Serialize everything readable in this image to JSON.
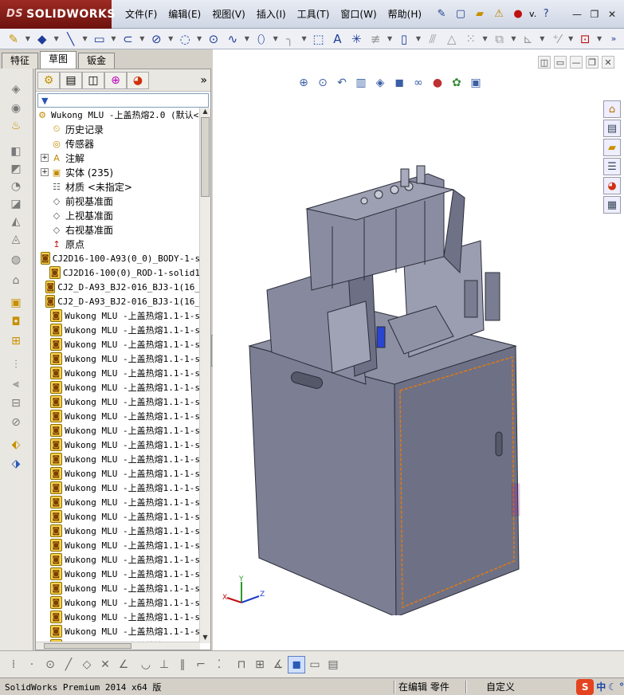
{
  "app": {
    "logo_text": "SOLIDWORKS",
    "logo_prefix": "DS",
    "menu": [
      "文件(F)",
      "编辑(E)",
      "视图(V)",
      "插入(I)",
      "工具(T)",
      "窗口(W)",
      "帮助(H)"
    ],
    "title_user": "v.",
    "title_help": "?"
  },
  "manager_tabs": [
    "特征",
    "草图",
    "钣金"
  ],
  "active_manager_tab": "草图",
  "tree": {
    "root": "Wukong MLU -上盖热熔2.0 (默认<",
    "items": [
      {
        "label": "历史记录",
        "icon": "history-icon",
        "expand": false,
        "cjk": true
      },
      {
        "label": "传感器",
        "icon": "sensor-icon",
        "expand": false,
        "cjk": true
      },
      {
        "label": "注解",
        "icon": "annotation-icon",
        "expand": true,
        "cjk": true
      },
      {
        "label": "实体 (235)",
        "icon": "solid-bodies-icon",
        "expand": true,
        "cjk": true
      },
      {
        "label": "材质 <未指定>",
        "icon": "material-icon",
        "expand": false,
        "cjk": true
      },
      {
        "label": "前视基准面",
        "icon": "plane-icon",
        "expand": false,
        "cjk": true
      },
      {
        "label": "上视基准面",
        "icon": "plane-icon",
        "expand": false,
        "cjk": true
      },
      {
        "label": "右视基准面",
        "icon": "plane-icon",
        "expand": false,
        "cjk": true
      },
      {
        "label": "原点",
        "icon": "origin-icon",
        "expand": false,
        "cjk": true
      },
      {
        "label": "CJ2D16-100-A93(0_0)_BODY-1-s",
        "icon": "part-icon",
        "expand": false,
        "cjk": false
      },
      {
        "label": "CJ2D16-100(0)_ROD-1-solid1",
        "icon": "part-icon",
        "expand": false,
        "cjk": false
      },
      {
        "label": "CJ2_D-A93_BJ2-016_BJ3-1(16_",
        "icon": "part-icon",
        "expand": false,
        "cjk": false
      },
      {
        "label": "CJ2_D-A93_BJ2-016_BJ3-1(16_",
        "icon": "part-icon",
        "expand": false,
        "cjk": false
      },
      {
        "label": "Wukong MLU -上盖热熔1.1-1-s",
        "icon": "part-icon",
        "expand": false,
        "cjk": false
      },
      {
        "label": "Wukong MLU -上盖热熔1.1-1-s",
        "icon": "part-icon",
        "expand": false,
        "cjk": false
      },
      {
        "label": "Wukong MLU -上盖热熔1.1-1-s",
        "icon": "part-icon",
        "expand": false,
        "cjk": false
      },
      {
        "label": "Wukong MLU -上盖热熔1.1-1-s",
        "icon": "part-icon",
        "expand": false,
        "cjk": false
      },
      {
        "label": "Wukong MLU -上盖热熔1.1-1-s",
        "icon": "part-icon",
        "expand": false,
        "cjk": false
      },
      {
        "label": "Wukong MLU -上盖热熔1.1-1-s",
        "icon": "part-icon",
        "expand": false,
        "cjk": false
      },
      {
        "label": "Wukong MLU -上盖热熔1.1-1-s",
        "icon": "part-icon",
        "expand": false,
        "cjk": false
      },
      {
        "label": "Wukong MLU -上盖热熔1.1-1-s",
        "icon": "part-icon",
        "expand": false,
        "cjk": false
      },
      {
        "label": "Wukong MLU -上盖热熔1.1-1-s",
        "icon": "part-icon",
        "expand": false,
        "cjk": false
      },
      {
        "label": "Wukong MLU -上盖热熔1.1-1-s",
        "icon": "part-icon",
        "expand": false,
        "cjk": false
      },
      {
        "label": "Wukong MLU -上盖热熔1.1-1-s",
        "icon": "part-icon",
        "expand": false,
        "cjk": false
      },
      {
        "label": "Wukong MLU -上盖热熔1.1-1-s",
        "icon": "part-icon",
        "expand": false,
        "cjk": false
      },
      {
        "label": "Wukong MLU -上盖热熔1.1-1-s",
        "icon": "part-icon",
        "expand": false,
        "cjk": false
      },
      {
        "label": "Wukong MLU -上盖热熔1.1-1-s",
        "icon": "part-icon",
        "expand": false,
        "cjk": false
      },
      {
        "label": "Wukong MLU -上盖热熔1.1-1-s",
        "icon": "part-icon",
        "expand": false,
        "cjk": false
      },
      {
        "label": "Wukong MLU -上盖热熔1.1-1-s",
        "icon": "part-icon",
        "expand": false,
        "cjk": false
      },
      {
        "label": "Wukong MLU -上盖热熔1.1-1-s",
        "icon": "part-icon",
        "expand": false,
        "cjk": false
      },
      {
        "label": "Wukong MLU -上盖热熔1.1-1-s",
        "icon": "part-icon",
        "expand": false,
        "cjk": false
      },
      {
        "label": "Wukong MLU -上盖热熔1.1-1-s",
        "icon": "part-icon",
        "expand": false,
        "cjk": false
      },
      {
        "label": "Wukong MLU -上盖热熔1.1-1-s",
        "icon": "part-icon",
        "expand": false,
        "cjk": false
      },
      {
        "label": "Wukong MLU -上盖热熔1.1-1-s",
        "icon": "part-icon",
        "expand": false,
        "cjk": false
      },
      {
        "label": "Wukong MLU -上盖热熔1.1-1-s",
        "icon": "part-icon",
        "expand": false,
        "cjk": false
      },
      {
        "label": "Wukong MLU -上盖热熔1.1-1-s",
        "icon": "part-icon",
        "expand": false,
        "cjk": false
      },
      {
        "label": "Wukong MLU -上盖热熔1.1-1-s",
        "icon": "part-icon",
        "expand": false,
        "cjk": false
      }
    ]
  },
  "status": {
    "product": "SolidWorks Premium 2014 x64 版",
    "mode": "在编辑 零件",
    "units": "自定义",
    "ime_logo": "S",
    "ime_lang": "中"
  },
  "triad": {
    "x": "X",
    "y": "Y",
    "z": "Z"
  },
  "colors": {
    "accent": "#2a5ab8",
    "logo": "#8b1d16",
    "model_body": "#7c7f94",
    "selection": "#e07a10"
  }
}
